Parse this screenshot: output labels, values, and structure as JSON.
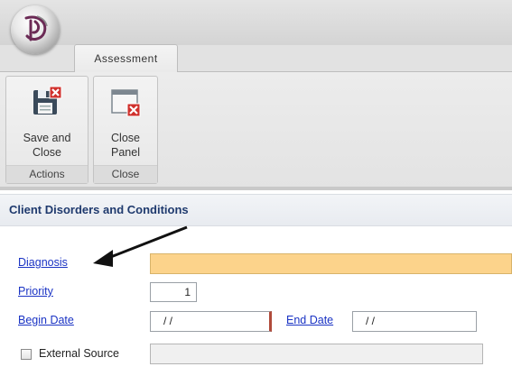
{
  "ribbon": {
    "tab": "Assessment",
    "groups": [
      {
        "name": "Actions",
        "buttons": [
          {
            "label_line1": "Save and",
            "label_line2": "Close"
          }
        ]
      },
      {
        "name": "Close",
        "buttons": [
          {
            "label_line1": "Close",
            "label_line2": "Panel"
          }
        ]
      }
    ]
  },
  "panel": {
    "title": "Client Disorders and Conditions",
    "fields": {
      "diagnosis": {
        "label": "Diagnosis",
        "value": ""
      },
      "priority": {
        "label": "Priority",
        "value": "1"
      },
      "begin_date": {
        "label": "Begin Date",
        "value": "/ /"
      },
      "end_date": {
        "label": "End Date",
        "value": "/ /"
      },
      "external_source": {
        "label": "External Source",
        "value": ""
      }
    }
  },
  "colors": {
    "required_field": "#fcd38b",
    "link_label": "#1a33c4",
    "header_text": "#1f3a6e"
  }
}
